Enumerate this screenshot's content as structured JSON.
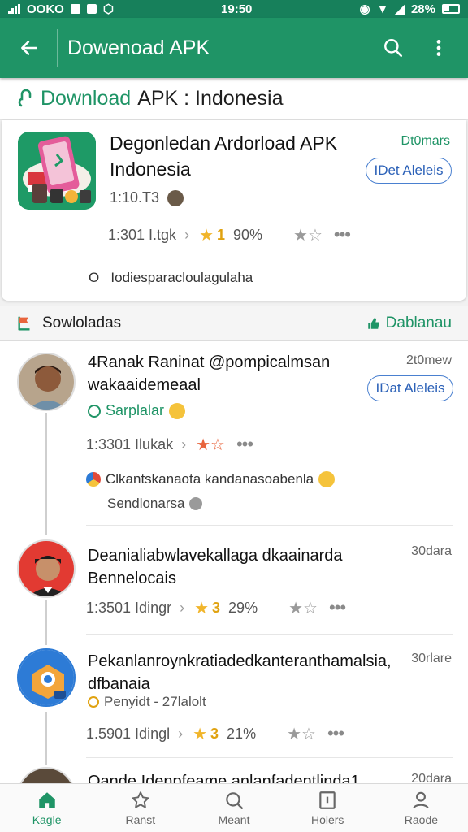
{
  "status": {
    "carrier": "OOKO",
    "time": "19:50",
    "battery": "28%"
  },
  "appbar": {
    "title": "Dowenoad APK"
  },
  "header": {
    "prefix": "Download",
    "suffix": "APK : Indonesia"
  },
  "card": {
    "title": "Degonledan Ardorload APK Indonesia",
    "date": "Dt0mars",
    "button": "IDet Aleleis",
    "version": "1:10.T3",
    "meta": "1:301 I.tgk",
    "rating": "1",
    "percent": "90%",
    "description": "Iodiesparacloulagulaha",
    "desc_prefix": "O"
  },
  "section": {
    "title": "Sowloladas",
    "action": "Dablanau"
  },
  "items": [
    {
      "title": "4Ranak Raninat @pompicalmsan wakaaidemeaal",
      "date": "2t0mew",
      "button": "IDat Aleleis",
      "sub": "Sarplalar",
      "meta": "1:3301 Ilukak",
      "comment": "Clkantskanaota kandanasoabenla",
      "comment2": "Sendlonarsa"
    },
    {
      "title": "Deanialiabwlavekallaga dkaainarda Bennelocais",
      "date": "30dara",
      "meta": "1:3501 Idingr",
      "rating": "3",
      "percent": "29%"
    },
    {
      "title": "Pekanlanroynkratiadedkanteranthamalsia, dfbanaia",
      "date": "30rlare",
      "sub": "Penyidt - 27lalolt",
      "meta": "1.5901 Idingl",
      "rating": "3",
      "percent": "21%"
    },
    {
      "title": "Oande Idenpfeame anlanfadentlinda1",
      "date": "20dara"
    }
  ],
  "nav": [
    "Kagle",
    "Ranst",
    "Meant",
    "Holers",
    "Raode"
  ],
  "colors": {
    "primary": "#1f9466",
    "accent": "#2d62b8",
    "star": "#f1b52b"
  }
}
